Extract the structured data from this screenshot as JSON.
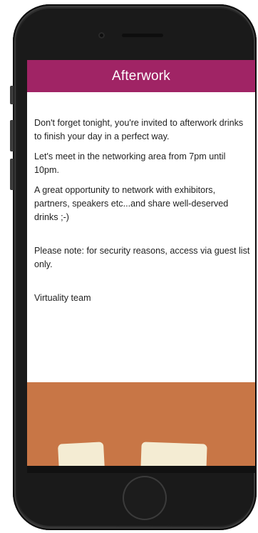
{
  "header": {
    "title": "Afterwork"
  },
  "message": {
    "paragraphs": [
      "Don't forget tonight, you're invited to afterwork drinks to finish your day in a perfect way.",
      "Let's meet in the networking area from 7pm until 10pm.",
      "A great opportunity to network with exhibitors, partners, speakers etc...and share well-deserved drinks ;-)",
      "Please note: for security reasons, access via guest list only.",
      "Virtuality team"
    ]
  },
  "colors": {
    "header_bg": "#a02465",
    "header_text": "#ffffff",
    "image_bg": "#c87646"
  }
}
